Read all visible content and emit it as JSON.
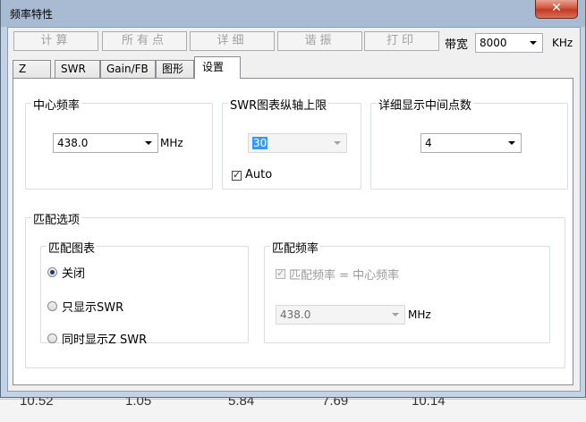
{
  "background": {
    "bottom_numbers": [
      "10.52",
      "1.05",
      "5.84",
      "7.69",
      "10.14"
    ]
  },
  "window": {
    "title": "频率特性",
    "close_glyph": "✕"
  },
  "toolbar": {
    "buttons": [
      "计算",
      "所有点",
      "详细",
      "谐振",
      "打印"
    ],
    "bandwidth_label": "带宽",
    "bandwidth_value": "8000",
    "bandwidth_unit": "KHz"
  },
  "tabs": [
    "Z",
    "SWR",
    "Gain/FB",
    "图形",
    "设置"
  ],
  "active_tab": "设置",
  "settings": {
    "center_freq": {
      "legend": "中心频率",
      "value": "438.0",
      "unit": "MHz"
    },
    "swr_axis": {
      "legend": "SWR图表纵轴上限",
      "value": "30",
      "auto_label": "Auto",
      "auto_checked": true
    },
    "detail_points": {
      "legend": "详细显示中间点数",
      "value": "4"
    },
    "match": {
      "legend": "匹配选项",
      "chart": {
        "legend": "匹配图表",
        "options": [
          "关闭",
          "只显示SWR",
          "同时显示Z SWR"
        ],
        "selected": "关闭"
      },
      "freq": {
        "legend": "匹配频率",
        "checkbox_label": "匹配频率 = 中心频率",
        "checked": true,
        "value": "438.0",
        "unit": "MHz"
      }
    }
  },
  "colors": {
    "title_bar": "#a9bbd3",
    "close_button": "#c23b22",
    "selection": "#3399ff"
  }
}
